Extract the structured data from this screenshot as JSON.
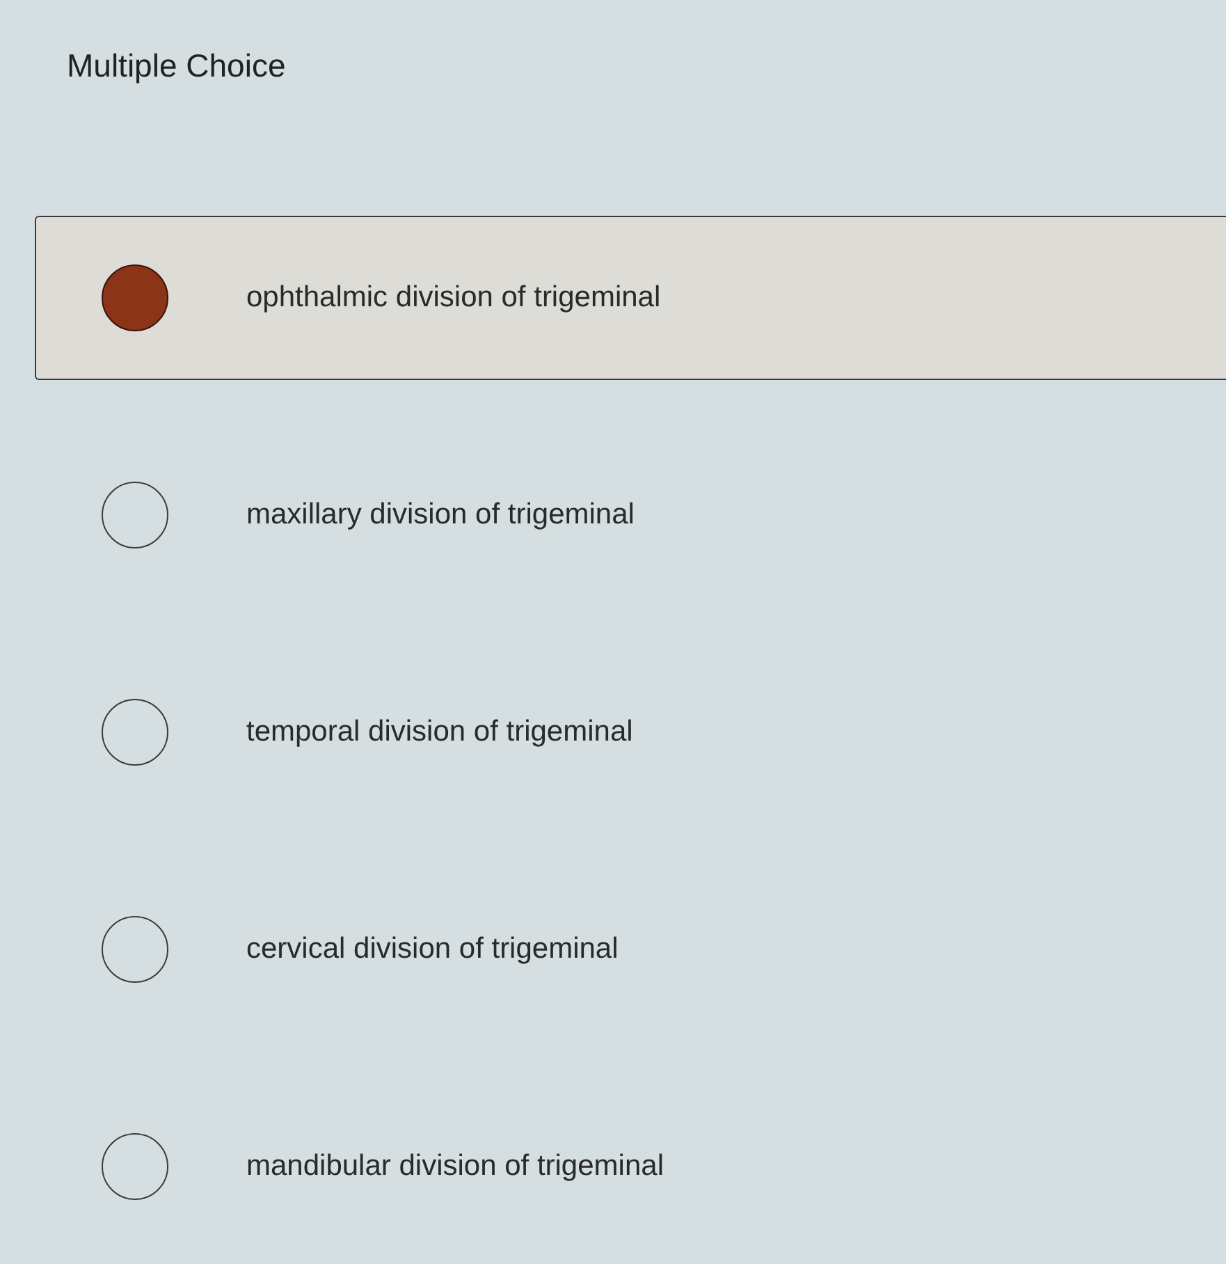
{
  "title": "Multiple Choice",
  "options": [
    {
      "label": "ophthalmic division of trigeminal",
      "selected": true
    },
    {
      "label": "maxillary division of trigeminal",
      "selected": false
    },
    {
      "label": "temporal division of trigeminal",
      "selected": false
    },
    {
      "label": "cervical division of trigeminal",
      "selected": false
    },
    {
      "label": "mandibular division of trigeminal",
      "selected": false
    }
  ]
}
